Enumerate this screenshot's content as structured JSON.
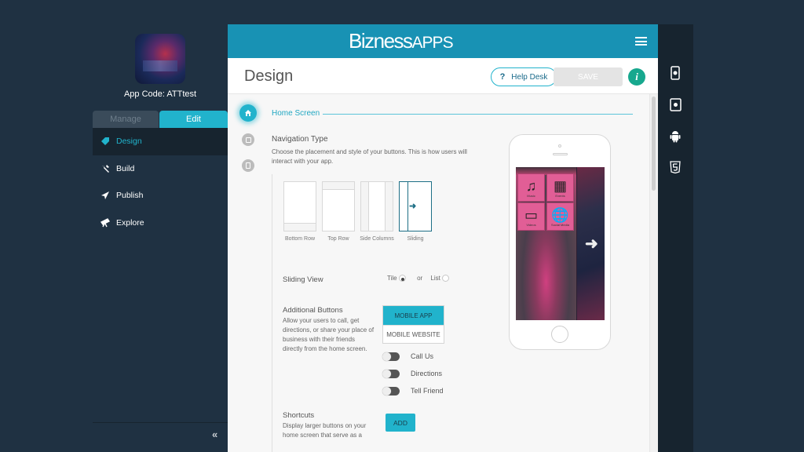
{
  "sidebar": {
    "app_code": "App Code: ATTtest",
    "tabs": [
      {
        "label": "Manage",
        "active": false
      },
      {
        "label": "Edit",
        "active": true
      }
    ],
    "items": [
      {
        "label": "Design",
        "icon": "tag-icon",
        "active": true
      },
      {
        "label": "Build",
        "icon": "wrench-icon",
        "active": false
      },
      {
        "label": "Publish",
        "icon": "paper-plane-icon",
        "active": false
      },
      {
        "label": "Explore",
        "icon": "telescope-icon",
        "active": false
      }
    ],
    "collapse_glyph": "«"
  },
  "topbar": {
    "logo_main": "Bizness",
    "logo_sub": "APPS"
  },
  "header": {
    "title": "Design",
    "help_label": "Help Desk",
    "help_glyph": "?",
    "save_label": "SAVE",
    "info_glyph": "i"
  },
  "section": {
    "title": "Home Screen"
  },
  "navigation_type": {
    "heading": "Navigation Type",
    "description": "Choose the placement and style of your buttons. This is how users will interact with your app.",
    "options": [
      {
        "label": "Bottom Row",
        "selected": false
      },
      {
        "label": "Top Row",
        "selected": false
      },
      {
        "label": "Side Columns",
        "selected": false
      },
      {
        "label": "Sliding",
        "selected": true
      }
    ],
    "sliding_arrow": "➜"
  },
  "sliding_view": {
    "label": "Sliding View",
    "tile_label": "Tile",
    "or_label": "or",
    "list_label": "List",
    "selected": "Tile"
  },
  "additional_buttons": {
    "heading": "Additional Buttons",
    "description": "Allow your users to call, get directions, or share your place of business with their friends directly from the home screen.",
    "segments": [
      {
        "label": "MOBILE APP",
        "active": true
      },
      {
        "label": "MOBILE WEBSITE",
        "active": false
      }
    ],
    "toggles": [
      {
        "label": "Call Us",
        "on": false
      },
      {
        "label": "Directions",
        "on": false
      },
      {
        "label": "Tell Friend",
        "on": false
      }
    ]
  },
  "shortcuts": {
    "heading": "Shortcuts",
    "description": "Display larger buttons on your home screen that serve as a",
    "add_label": "ADD"
  },
  "preview": {
    "tiles": [
      {
        "label": "Music",
        "glyph": "♫"
      },
      {
        "label": "Events",
        "glyph": "▦"
      },
      {
        "label": "Videos",
        "glyph": "▭"
      },
      {
        "label": "Social Media",
        "glyph": "🌐"
      }
    ],
    "arrow_glyph": "➜"
  },
  "platforms": [
    {
      "name": "iphone-icon"
    },
    {
      "name": "ipad-icon"
    },
    {
      "name": "android-icon"
    },
    {
      "name": "html5-icon"
    }
  ]
}
